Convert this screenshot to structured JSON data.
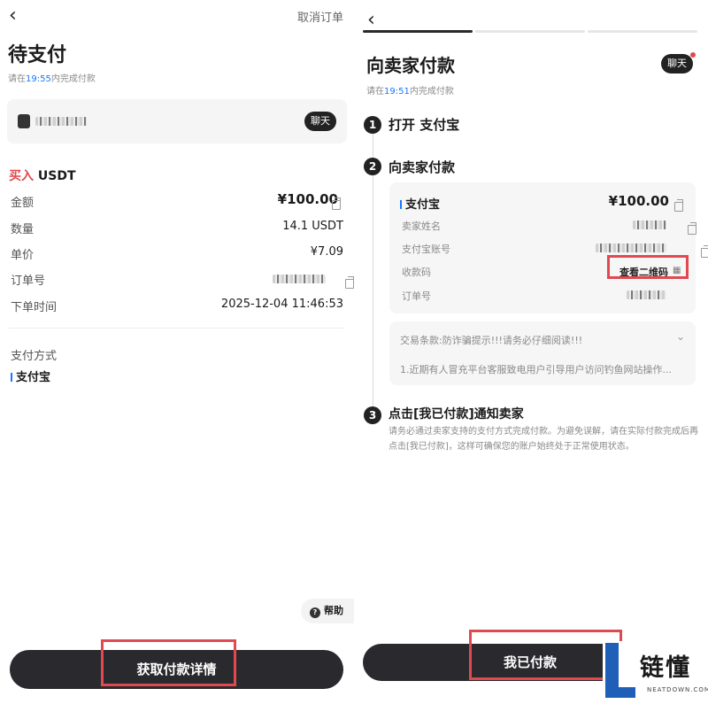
{
  "left": {
    "cancel_label": "取消订单",
    "title": "待支付",
    "countdown_prefix": "请在",
    "countdown_time": "19:55",
    "countdown_suffix": "内完成付款",
    "seller_chat_label": "聊天",
    "buy_label": "买入",
    "asset": "USDT",
    "rows": [
      {
        "label": "金额",
        "value": "¥100.00"
      },
      {
        "label": "数量",
        "value": "14.1 USDT"
      },
      {
        "label": "单价",
        "value": "¥7.09"
      },
      {
        "label": "订单号",
        "value": ""
      },
      {
        "label": "下单时间",
        "value": "2025-12-04 11:46:53"
      }
    ],
    "payment_method_label": "支付方式",
    "payment_method_value": "支付宝",
    "help_label": "帮助",
    "primary_button": "获取付款详情"
  },
  "right": {
    "title": "向卖家付款",
    "chat_label": "聊天",
    "countdown_prefix": "请在",
    "countdown_time": "19:51",
    "countdown_suffix": "内完成付款",
    "steps": [
      {
        "num": "1",
        "title": "打开 支付宝"
      },
      {
        "num": "2",
        "title": "向卖家付款"
      },
      {
        "num": "3",
        "title": "点击[我已付款]通知卖家"
      }
    ],
    "card": {
      "method": "支付宝",
      "amount": "¥100.00",
      "rows": [
        {
          "label": "卖家姓名"
        },
        {
          "label": "支付宝账号"
        },
        {
          "label": "收款码",
          "value": "查看二维码"
        },
        {
          "label": "订单号"
        }
      ]
    },
    "terms_title": "交易条款:防诈骗提示!!!请务必仔细阅读!!!",
    "terms_body": "1.近期有人冒充平台客服致电用户引导用户访问钓鱼网站操作...",
    "step3_desc": "请务必通过卖家支持的支付方式完成付款。为避免误解，请在实际付款完成后再点击[我已付款]，这样可确保您的账户始终处于正常使用状态。",
    "primary_button": "我已付款"
  },
  "watermark": {
    "logo_letter": "L",
    "text": "链懂",
    "sub": "NEATDOWN.COM"
  },
  "colors": {
    "accent_red": "#e0494f",
    "buy_red": "#e0494f",
    "link_blue": "#1677ff",
    "dark_button": "#2a2a2e",
    "watermark_blue": "#1f5fb8"
  }
}
